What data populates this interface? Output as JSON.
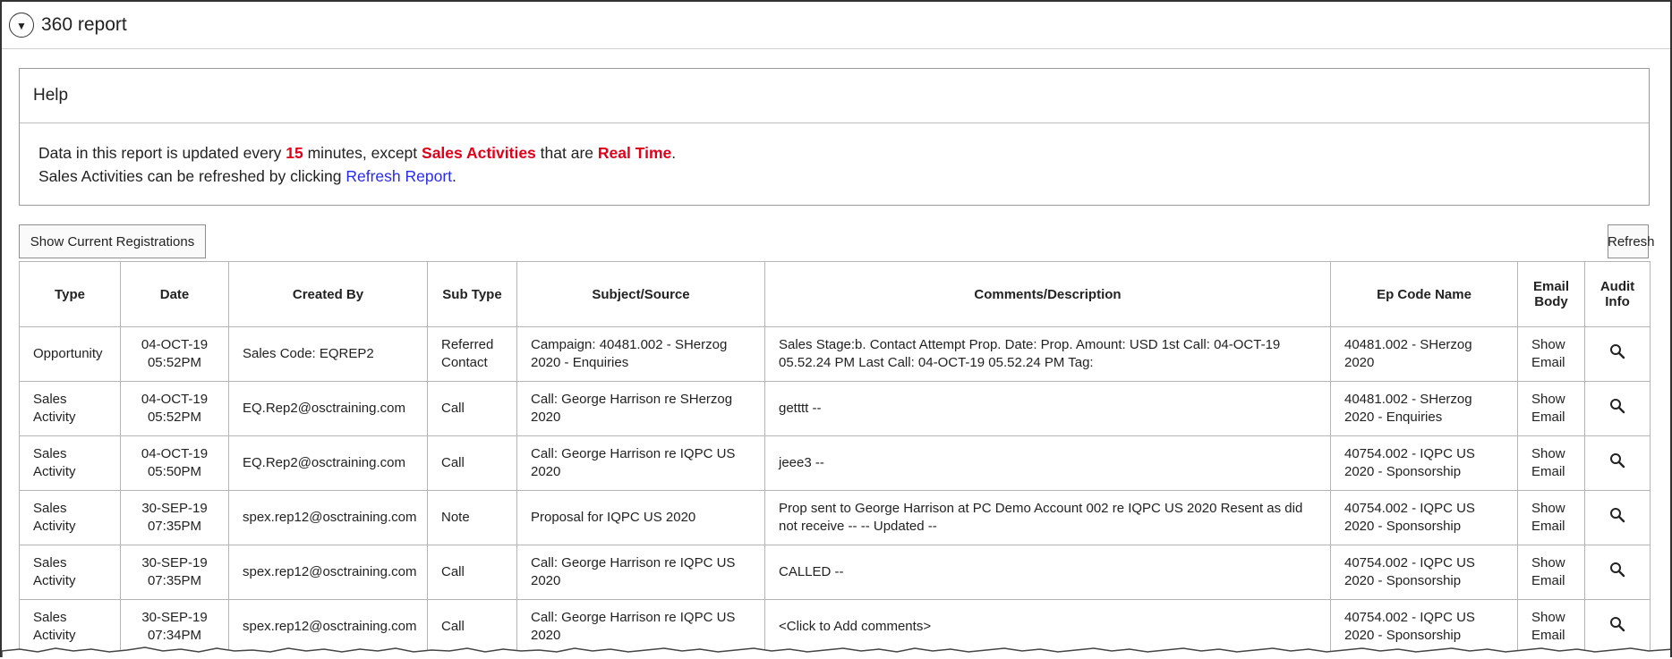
{
  "header": {
    "title": "360 report",
    "toggle_icon": "triangle-down-icon"
  },
  "help": {
    "title": "Help",
    "line1_pre": "Data in this report is updated every ",
    "line1_num": "15",
    "line1_mid": " minutes, except ",
    "line1_hl1": "Sales Activities",
    "line1_mid2": " that are ",
    "line1_hl2": "Real Time",
    "line1_end": ".",
    "line2_pre": "Sales Activities can be refreshed by clicking ",
    "line2_link": "Refresh Report",
    "line2_end": ".",
    "highlight_color": "#e0001b",
    "link_color": "#2a2ae8"
  },
  "toolbar": {
    "show_registrations": "Show Current Registrations",
    "refresh": "Refresh"
  },
  "table": {
    "headers": [
      "Type",
      "Date",
      "Created By",
      "Sub Type",
      "Subject/Source",
      "Comments/Description",
      "Ep Code Name",
      "Email Body",
      "Audit Info"
    ],
    "rows": [
      {
        "type": "Opportunity",
        "date": "04-OCT-19 05:52PM",
        "created_by": "Sales Code: EQREP2",
        "sub_type": "Referred Contact",
        "subject": "Campaign: 40481.002 - SHerzog 2020 - Enquiries",
        "comments": "Sales Stage:b. Contact Attempt Prop. Date: Prop. Amount: USD 1st Call: 04-OCT-19 05.52.24 PM Last Call: 04-OCT-19 05.52.24 PM Tag:",
        "ep_code": "40481.002 - SHerzog 2020",
        "email": "Show Email",
        "audit_icon": "magnifier-icon"
      },
      {
        "type": "Sales Activity",
        "date": "04-OCT-19 05:52PM",
        "created_by": "EQ.Rep2@osctraining.com",
        "sub_type": "Call",
        "subject": "Call: George Harrison re SHerzog 2020",
        "comments": "getttt --",
        "ep_code": "40481.002 - SHerzog 2020 - Enquiries",
        "email": "Show Email",
        "audit_icon": "magnifier-icon"
      },
      {
        "type": "Sales Activity",
        "date": "04-OCT-19 05:50PM",
        "created_by": "EQ.Rep2@osctraining.com",
        "sub_type": "Call",
        "subject": "Call: George Harrison re IQPC US 2020",
        "comments": "jeee3 --",
        "ep_code": "40754.002 - IQPC US 2020 - Sponsorship",
        "email": "Show Email",
        "audit_icon": "magnifier-icon"
      },
      {
        "type": "Sales Activity",
        "date": "30-SEP-19 07:35PM",
        "created_by": "spex.rep12@osctraining.com",
        "sub_type": "Note",
        "subject": "Proposal for IQPC US 2020",
        "comments": "Prop sent to George Harrison at PC Demo Account 002 re IQPC US 2020 Resent as did not receive -- -- Updated --",
        "ep_code": "40754.002 - IQPC US 2020 - Sponsorship",
        "email": "Show Email",
        "audit_icon": "magnifier-icon"
      },
      {
        "type": "Sales Activity",
        "date": "30-SEP-19 07:35PM",
        "created_by": "spex.rep12@osctraining.com",
        "sub_type": "Call",
        "subject": "Call: George Harrison re IQPC US 2020",
        "comments": "CALLED --",
        "ep_code": "40754.002 - IQPC US 2020 - Sponsorship",
        "email": "Show Email",
        "audit_icon": "magnifier-icon"
      },
      {
        "type": "Sales Activity",
        "date": "30-SEP-19 07:34PM",
        "created_by": "spex.rep12@osctraining.com",
        "sub_type": "Call",
        "subject": "Call: George Harrison re IQPC US 2020",
        "comments": "<Click to Add comments>",
        "ep_code": "40754.002 - IQPC US 2020 - Sponsorship",
        "email": "Show Email",
        "audit_icon": "magnifier-icon"
      }
    ]
  }
}
